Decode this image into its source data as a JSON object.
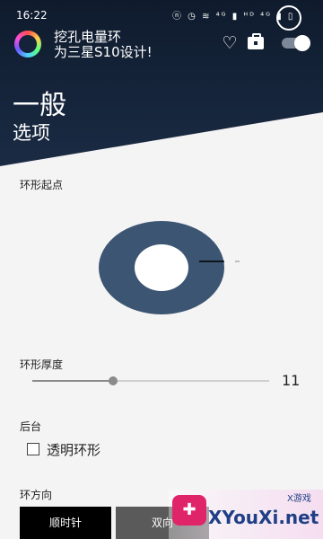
{
  "status": {
    "time": "16:22",
    "icons": "ⓝ ◷ ≋ ⁴ᴳ ▮ ᴴᴰ ⁴ᴳ ▮ ▯"
  },
  "app": {
    "title_line1": "挖孔电量环",
    "title_line2": "为三星S10设计!"
  },
  "header": {
    "heading": "一般",
    "subheading": "选项"
  },
  "ring_start": {
    "label": "环形起点"
  },
  "ring_thickness": {
    "label": "环形厚度",
    "value": "11",
    "value_fraction": 0.34
  },
  "background": {
    "label": "后台",
    "checkbox_label": "透明环形",
    "checked": false
  },
  "direction": {
    "label": "环方向",
    "options": [
      "顺时针",
      "双向"
    ],
    "selected": "顺时针"
  },
  "watermark": {
    "brand": "XYouXi.net",
    "small": "X游戏",
    "logo": "✚"
  },
  "colors": {
    "header_bg": "#0f1b2d",
    "donut": "#3c5573",
    "selected_btn": "#000000",
    "unselected_btn": "#5a5a5a"
  }
}
